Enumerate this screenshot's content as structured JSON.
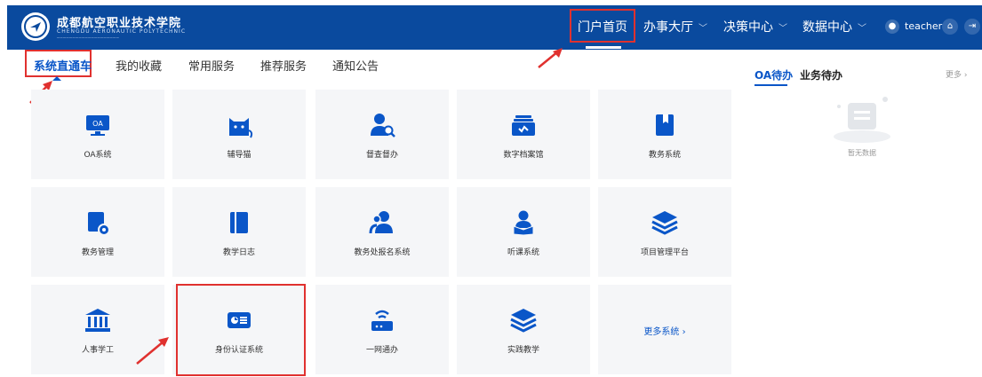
{
  "header": {
    "school_name_cn": "成都航空职业技术学院",
    "school_name_en": "CHENGDU AERONAUTIC POLYTECHNIC",
    "nav": [
      {
        "label": "门户首页"
      },
      {
        "label": "办事大厅"
      },
      {
        "label": "决策中心"
      },
      {
        "label": "数据中心"
      }
    ],
    "user": "teacher"
  },
  "tabs": [
    "系统直通车",
    "我的收藏",
    "常用服务",
    "推荐服务",
    "通知公告"
  ],
  "tiles": [
    {
      "label": "OA系统",
      "icon": "oa-monitor-icon"
    },
    {
      "label": "辅导猫",
      "icon": "cat-icon"
    },
    {
      "label": "督查督办",
      "icon": "user-search-icon"
    },
    {
      "label": "数字档案馆",
      "icon": "archive-icon"
    },
    {
      "label": "教务系统",
      "icon": "bookmark-book-icon"
    },
    {
      "label": "教务管理",
      "icon": "book-gear-icon"
    },
    {
      "label": "教学日志",
      "icon": "notebook-icon"
    },
    {
      "label": "教务处报名系统",
      "icon": "users-icon"
    },
    {
      "label": "听课系统",
      "icon": "reader-icon"
    },
    {
      "label": "项目管理平台",
      "icon": "layers-icon"
    },
    {
      "label": "人事学工",
      "icon": "building-icon"
    },
    {
      "label": "身份认证系统",
      "icon": "id-card-icon"
    },
    {
      "label": "一网通办",
      "icon": "wifi-router-icon"
    },
    {
      "label": "实践教学",
      "icon": "layers-icon"
    }
  ],
  "more_systems": "更多系统 ›",
  "right_panel": {
    "tabs": [
      "OA待办",
      "业务待办"
    ],
    "more": "更多 ›",
    "empty": "暂无数据"
  },
  "colors": {
    "brand": "#0a4a9e",
    "accent": "#0a56c8",
    "highlight": "#e0312f",
    "tile_bg": "#f5f6f8"
  }
}
